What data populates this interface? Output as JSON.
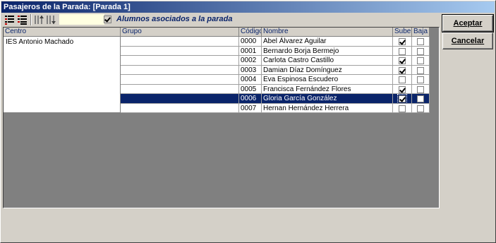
{
  "window": {
    "title": "Pasajeros de la Parada: [Parada 1]"
  },
  "toolbar": {
    "buttons": [
      {
        "icon": "list-expand-icon"
      },
      {
        "icon": "list-collapse-icon"
      },
      {
        "icon": "column-sort-asc-icon"
      },
      {
        "icon": "column-sort-desc-icon"
      }
    ],
    "assoc_checkbox_checked": true,
    "assoc_label": "Alumnos asociados a la parada"
  },
  "grid": {
    "headers": {
      "centro": "Centro",
      "grupo": "Grupo",
      "codigo": "Código",
      "nombre": "Nombre",
      "sube": "Sube",
      "baja": "Baja"
    },
    "centro_value": "IES Antonio Machado",
    "rows": [
      {
        "codigo": "0000",
        "nombre": "Abel Álvarez Aguilar",
        "sube": true,
        "baja": false
      },
      {
        "codigo": "0001",
        "nombre": "Bernardo Borja Bermejo",
        "sube": false,
        "baja": false
      },
      {
        "codigo": "0002",
        "nombre": "Carlota Castro Castillo",
        "sube": true,
        "baja": false
      },
      {
        "codigo": "0003",
        "nombre": "Damian Díaz Domínguez",
        "sube": true,
        "baja": false
      },
      {
        "codigo": "0004",
        "nombre": "Eva Espinosa Escudero",
        "sube": false,
        "baja": false
      },
      {
        "codigo": "0005",
        "nombre": "Francisca Fernández Flores",
        "sube": true,
        "baja": false
      },
      {
        "codigo": "0006",
        "nombre": "Gloria García González",
        "sube": true,
        "baja": false,
        "selected": true
      },
      {
        "codigo": "0007",
        "nombre": "Hernan Hernández Herrera",
        "sube": false,
        "baja": false
      }
    ]
  },
  "buttons": {
    "accept_label": "Aceptar",
    "cancel_label": "Cancelar"
  },
  "colors": {
    "title_gradient_start": "#0a246a",
    "selection": "#0a246a",
    "face": "#d4d0c8"
  }
}
